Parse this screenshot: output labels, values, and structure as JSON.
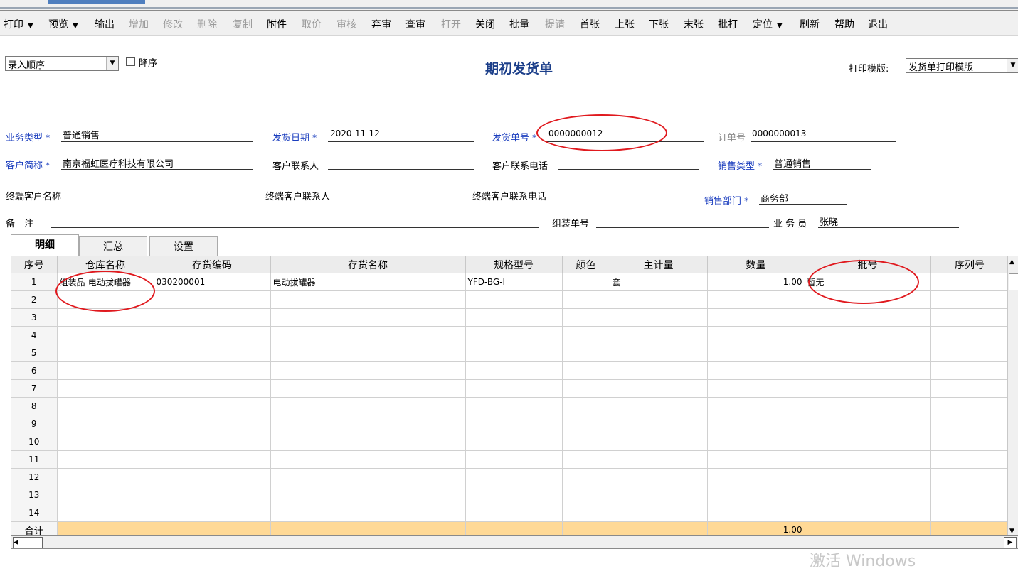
{
  "toolbar": {
    "items": [
      {
        "label": "打印",
        "dropdown": true,
        "disabled": false
      },
      {
        "label": "预览",
        "dropdown": true,
        "disabled": false
      },
      {
        "label": "输出",
        "dropdown": false,
        "disabled": false
      },
      {
        "label": "增加",
        "dropdown": false,
        "disabled": true
      },
      {
        "label": "修改",
        "dropdown": false,
        "disabled": true
      },
      {
        "label": "删除",
        "dropdown": false,
        "disabled": true
      },
      {
        "label": "复制",
        "dropdown": false,
        "disabled": true
      },
      {
        "label": "附件",
        "dropdown": false,
        "disabled": false
      },
      {
        "label": "取价",
        "dropdown": false,
        "disabled": true
      },
      {
        "label": "审核",
        "dropdown": false,
        "disabled": true
      },
      {
        "label": "弃审",
        "dropdown": false,
        "disabled": false
      },
      {
        "label": "查审",
        "dropdown": false,
        "disabled": false
      },
      {
        "label": "打开",
        "dropdown": false,
        "disabled": true
      },
      {
        "label": "关闭",
        "dropdown": false,
        "disabled": false
      },
      {
        "label": "批量",
        "dropdown": false,
        "disabled": false
      },
      {
        "label": "提请",
        "dropdown": false,
        "disabled": true
      },
      {
        "label": "首张",
        "dropdown": false,
        "disabled": false
      },
      {
        "label": "上张",
        "dropdown": false,
        "disabled": false
      },
      {
        "label": "下张",
        "dropdown": false,
        "disabled": false
      },
      {
        "label": "末张",
        "dropdown": false,
        "disabled": false
      },
      {
        "label": "批打",
        "dropdown": false,
        "disabled": false
      },
      {
        "label": "定位",
        "dropdown": true,
        "disabled": false
      },
      {
        "label": "刷新",
        "dropdown": false,
        "disabled": false
      },
      {
        "label": "帮助",
        "dropdown": false,
        "disabled": false
      },
      {
        "label": "退出",
        "dropdown": false,
        "disabled": false
      }
    ]
  },
  "sort": {
    "value": "录入顺序",
    "desc_label": "降序",
    "desc_checked": false
  },
  "title": "期初发货单",
  "print_template": {
    "label": "打印模版:",
    "value": "发货单打印模版"
  },
  "fields": {
    "biz_type": {
      "label": "业务类型",
      "value": "普通销售"
    },
    "ship_date": {
      "label": "发货日期",
      "value": "2020-11-12"
    },
    "ship_no": {
      "label": "发货单号",
      "value": "0000000012"
    },
    "order_no": {
      "label": "订单号",
      "value": "0000000013"
    },
    "customer": {
      "label": "客户简称",
      "value": "南京福虹医疗科技有限公司"
    },
    "cust_contact": {
      "label": "客户联系人",
      "value": ""
    },
    "cust_phone": {
      "label": "客户联系电话",
      "value": ""
    },
    "sales_type": {
      "label": "销售类型",
      "value": "普通销售"
    },
    "end_customer": {
      "label": "终端客户名称",
      "value": ""
    },
    "end_contact": {
      "label": "终端客户联系人",
      "value": ""
    },
    "end_phone": {
      "label": "终端客户联系电话",
      "value": ""
    },
    "sales_dept": {
      "label": "销售部门",
      "value": "商务部"
    },
    "remark": {
      "label": "备　注",
      "value": ""
    },
    "assembly_no": {
      "label": "组装单号",
      "value": ""
    },
    "salesperson": {
      "label": "业 务 员",
      "value": "张晓"
    }
  },
  "tabs": [
    "明细",
    "汇总",
    "设置"
  ],
  "grid": {
    "headers": [
      "序号",
      "仓库名称",
      "存货编码",
      "存货名称",
      "规格型号",
      "颜色",
      "主计量",
      "数量",
      "批号",
      "序列号"
    ],
    "rows": [
      [
        "1",
        "组装品-电动拔罐器",
        "030200001",
        "电动拔罐器",
        "YFD-BG-I",
        "",
        "套",
        "1.00",
        "暂无",
        ""
      ],
      [
        "2",
        "",
        "",
        "",
        "",
        "",
        "",
        "",
        "",
        ""
      ],
      [
        "3",
        "",
        "",
        "",
        "",
        "",
        "",
        "",
        "",
        ""
      ],
      [
        "4",
        "",
        "",
        "",
        "",
        "",
        "",
        "",
        "",
        ""
      ],
      [
        "5",
        "",
        "",
        "",
        "",
        "",
        "",
        "",
        "",
        ""
      ],
      [
        "6",
        "",
        "",
        "",
        "",
        "",
        "",
        "",
        "",
        ""
      ],
      [
        "7",
        "",
        "",
        "",
        "",
        "",
        "",
        "",
        "",
        ""
      ],
      [
        "8",
        "",
        "",
        "",
        "",
        "",
        "",
        "",
        "",
        ""
      ],
      [
        "9",
        "",
        "",
        "",
        "",
        "",
        "",
        "",
        "",
        ""
      ],
      [
        "10",
        "",
        "",
        "",
        "",
        "",
        "",
        "",
        "",
        ""
      ],
      [
        "11",
        "",
        "",
        "",
        "",
        "",
        "",
        "",
        "",
        ""
      ],
      [
        "12",
        "",
        "",
        "",
        "",
        "",
        "",
        "",
        "",
        ""
      ],
      [
        "13",
        "",
        "",
        "",
        "",
        "",
        "",
        "",
        "",
        ""
      ],
      [
        "14",
        "",
        "",
        "",
        "",
        "",
        "",
        "",
        "",
        ""
      ]
    ],
    "total_label": "合计",
    "total_qty": "1.00"
  },
  "watermark": "激活 Windows",
  "colors": {
    "highlight_circle": "#e0191e",
    "total_row": "#ffd996",
    "title": "#1c3f8a",
    "label_blue": "#1c3fbf"
  }
}
